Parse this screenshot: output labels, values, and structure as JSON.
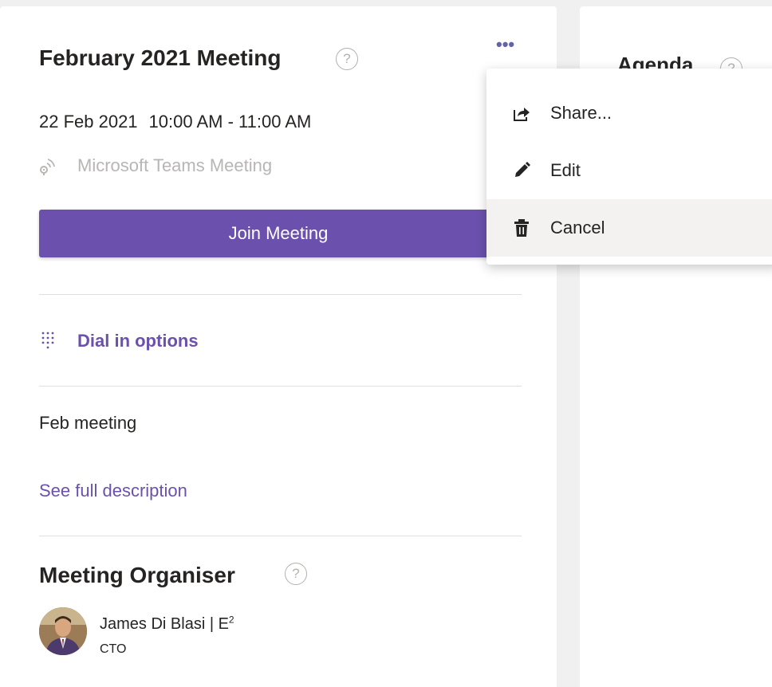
{
  "meeting": {
    "title": "February 2021 Meeting",
    "help_glyph": "?",
    "more_glyph": "•••",
    "date": "22 Feb 2021",
    "time": "10:00 AM - 11:00 AM",
    "location": "Microsoft Teams Meeting",
    "join_label": "Join Meeting",
    "dial_label": "Dial in options",
    "description": "Feb meeting",
    "see_full_label": "See full description"
  },
  "organiser": {
    "heading": "Meeting Organiser",
    "name": "James Di Blasi | E",
    "name_sup": "2",
    "role": "CTO"
  },
  "agenda": {
    "title": "Agenda"
  },
  "context_menu": {
    "items": [
      {
        "label": "Share...",
        "icon": "share-icon"
      },
      {
        "label": "Edit",
        "icon": "pencil-icon"
      },
      {
        "label": "Cancel",
        "icon": "trash-icon"
      }
    ]
  },
  "colors": {
    "accent": "#6b51ad",
    "more_dots": "#6264a7",
    "muted_text": "#b8b6b4",
    "hover_bg": "#f3f2f1"
  }
}
